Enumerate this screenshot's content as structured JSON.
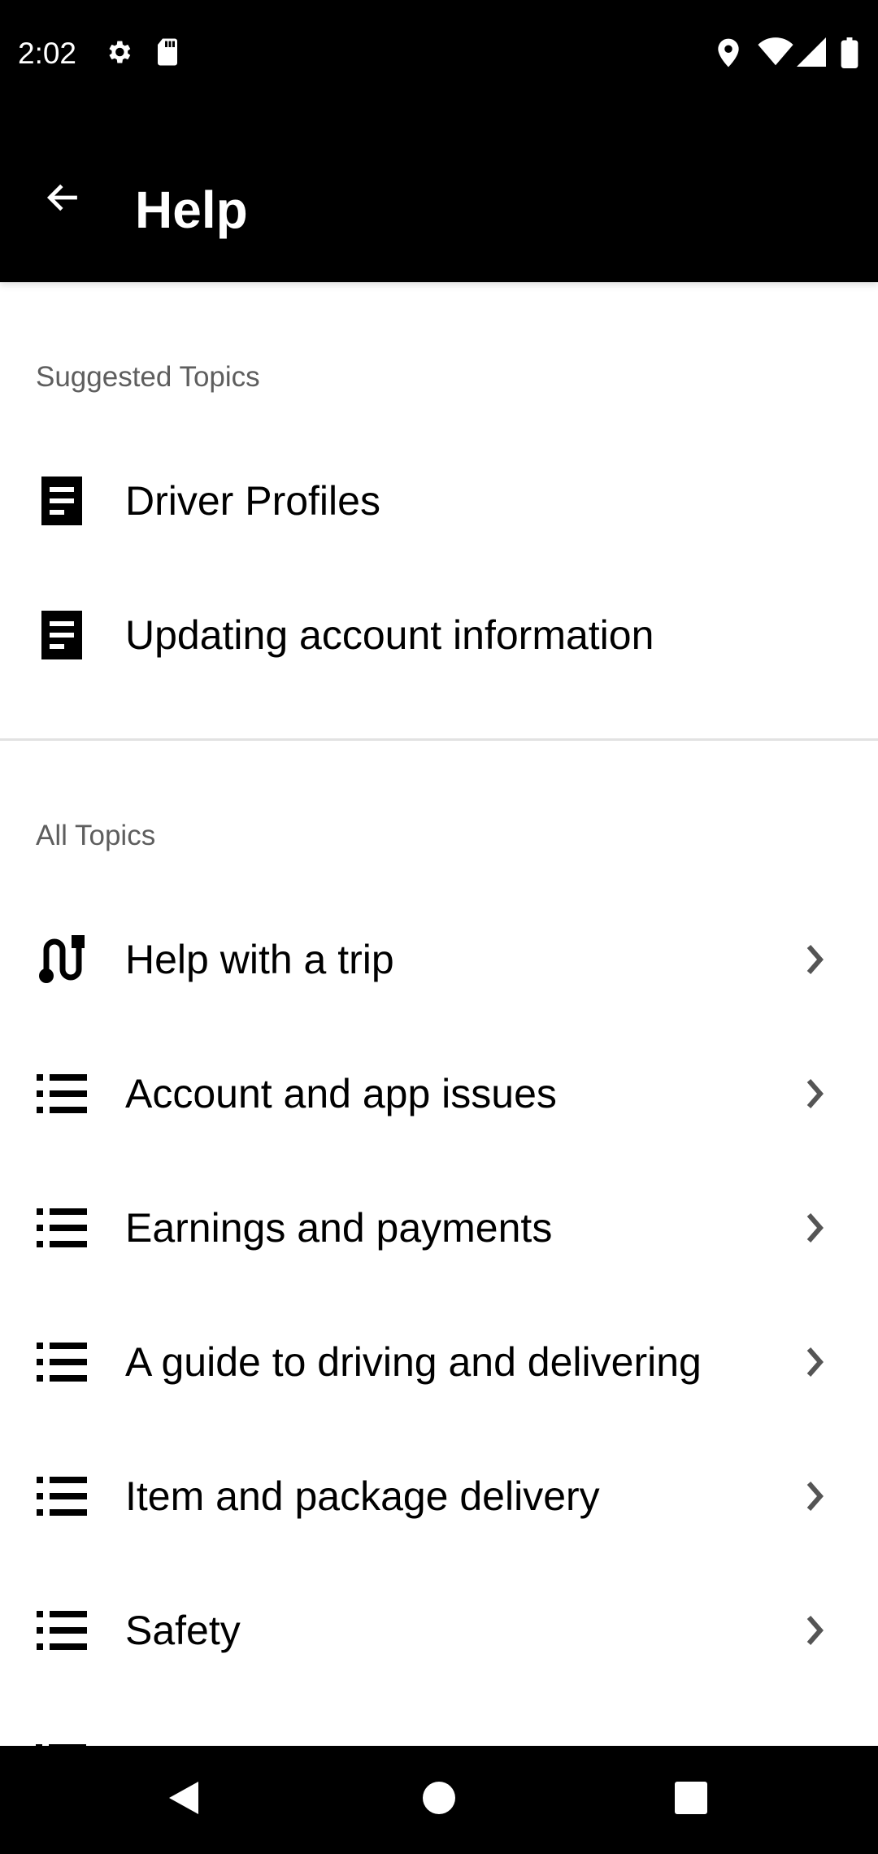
{
  "status_bar": {
    "time": "2:02",
    "left_icons": [
      "gear-icon",
      "sd-card-icon"
    ],
    "right_icons": [
      "location-icon",
      "wifi-icon",
      "signal-icon",
      "battery-icon"
    ]
  },
  "app_bar": {
    "title": "Help",
    "back_icon": "arrow-left-icon"
  },
  "suggested": {
    "header": "Suggested Topics",
    "items": [
      {
        "label": "Driver Profiles",
        "icon": "article-icon"
      },
      {
        "label": "Updating account information",
        "icon": "article-icon"
      }
    ]
  },
  "all_topics": {
    "header": "All Topics",
    "items": [
      {
        "label": "Help with a trip",
        "icon": "route-icon"
      },
      {
        "label": "Account and app issues",
        "icon": "list-icon"
      },
      {
        "label": "Earnings and payments",
        "icon": "list-icon"
      },
      {
        "label": "A guide to driving and delivering",
        "icon": "list-icon"
      },
      {
        "label": "Item and package delivery",
        "icon": "list-icon"
      },
      {
        "label": "Safety",
        "icon": "list-icon"
      }
    ]
  },
  "nav_bar": {
    "buttons": [
      "back-triangle-icon",
      "home-circle-icon",
      "recents-square-icon"
    ]
  }
}
